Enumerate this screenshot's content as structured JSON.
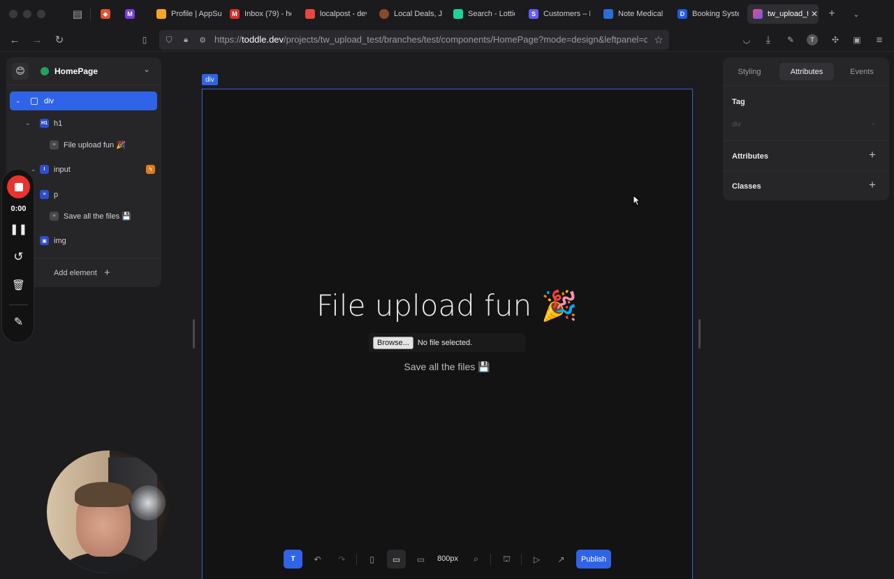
{
  "browser": {
    "tabs": [
      {
        "title": "Profile | AppSu",
        "color": "#f5a623"
      },
      {
        "title": "Inbox (79) - he",
        "color": "#d93025"
      },
      {
        "title": "localpost - dev",
        "color": "#e8473f"
      },
      {
        "title": "Local Deals, Jo",
        "color": "#8a4a2a"
      },
      {
        "title": "Search - Lottie",
        "color": "#1fd19a"
      },
      {
        "title": "Customers – Lo",
        "color": "#635bff"
      },
      {
        "title": "Note Medical V",
        "color": "#2a6fd8"
      },
      {
        "title": "Booking Syste",
        "color": "#1e5be8"
      },
      {
        "title": "tw_upload_t",
        "color": "#2f2f33"
      }
    ],
    "url_prefix": "https://",
    "url_domain": "toddle.dev",
    "url_path": "/projects/tw_upload_test/branches/test/components/HomePage?mode=design&leftpanel=d"
  },
  "left_panel": {
    "emoji": "😊",
    "page_name": "HomePage",
    "tree": [
      {
        "label": "div",
        "icon": "box"
      },
      {
        "label": "h1",
        "icon": "H1"
      },
      {
        "label": "File upload fun 🎉",
        "icon": "text"
      },
      {
        "label": "input",
        "icon": "I"
      },
      {
        "label": "p",
        "icon": "text"
      },
      {
        "label": "Save all the files 💾",
        "icon": "text"
      },
      {
        "label": "img",
        "icon": "img"
      }
    ],
    "add_element": "Add element"
  },
  "recorder": {
    "time": "0:00"
  },
  "canvas": {
    "selected_tag": "div",
    "h1": "File upload fun 🎉",
    "browse_label": "Browse...",
    "file_status": "No file selected.",
    "p": "Save all the files 💾"
  },
  "toolbar": {
    "t_label": "T",
    "size": "800px",
    "publish": "Publish"
  },
  "right_panel": {
    "tabs": [
      "Styling",
      "Attributes",
      "Events"
    ],
    "active_tab": "Attributes",
    "tag_label": "Tag",
    "tag_value": "div",
    "attributes_label": "Attributes",
    "classes_label": "Classes"
  },
  "colors": {
    "accent": "#2f64e8",
    "record": "#e8332f",
    "warning": "#e07a1a"
  }
}
